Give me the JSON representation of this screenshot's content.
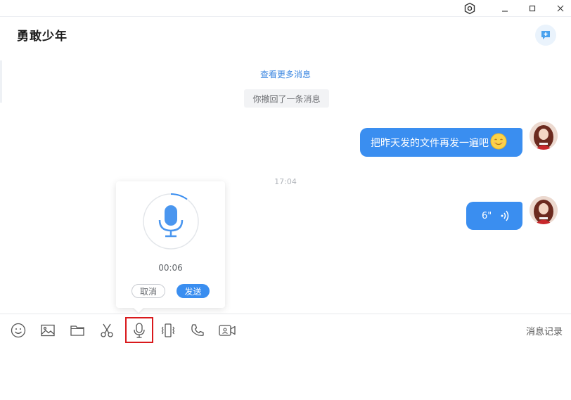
{
  "header": {
    "title": "勇敢少年"
  },
  "messages": {
    "view_more": "查看更多消息",
    "recall_notice": "你撤回了一条消息",
    "text_message": "把昨天发的文件再发一遍吧",
    "time": "17:04",
    "voice_duration": "6\""
  },
  "recorder": {
    "elapsed": "00:06",
    "cancel_label": "取消",
    "send_label": "发送",
    "progress": 0.1
  },
  "toolbar": {
    "tools": [
      "emoji-icon",
      "image-icon",
      "folder-icon",
      "scissors-icon",
      "voice-input-icon",
      "shake-icon",
      "phone-icon",
      "video-call-icon"
    ],
    "history_label": "消息记录"
  },
  "colors": {
    "accent": "#3a8ef0",
    "highlight": "#d9191c"
  }
}
